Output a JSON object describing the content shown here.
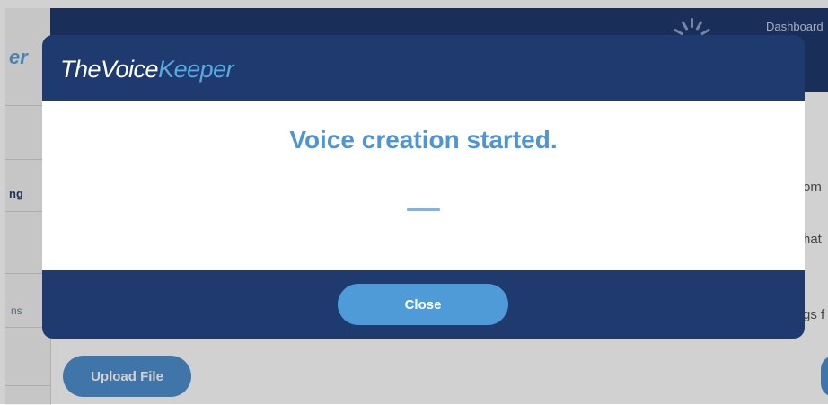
{
  "background": {
    "brand_fragment": "er",
    "nav_fragment_1": "ng",
    "nav_fragment_2": "ns",
    "dashboard_link": "Dashboard",
    "text_fragments": [
      "om",
      "hat",
      "gs f"
    ],
    "upload_button_label": "Upload File"
  },
  "modal": {
    "logo_part1": "TheVoice",
    "logo_part2": "Keeper",
    "message": "Voice creation started.",
    "close_button_label": "Close"
  },
  "colors": {
    "navy": "#1f3a6e",
    "accent_blue": "#4e9bd8",
    "message_blue": "#4e95d3",
    "logo_light_blue": "#5aa8e0"
  },
  "icons": [
    "loading-spinner-icon"
  ]
}
